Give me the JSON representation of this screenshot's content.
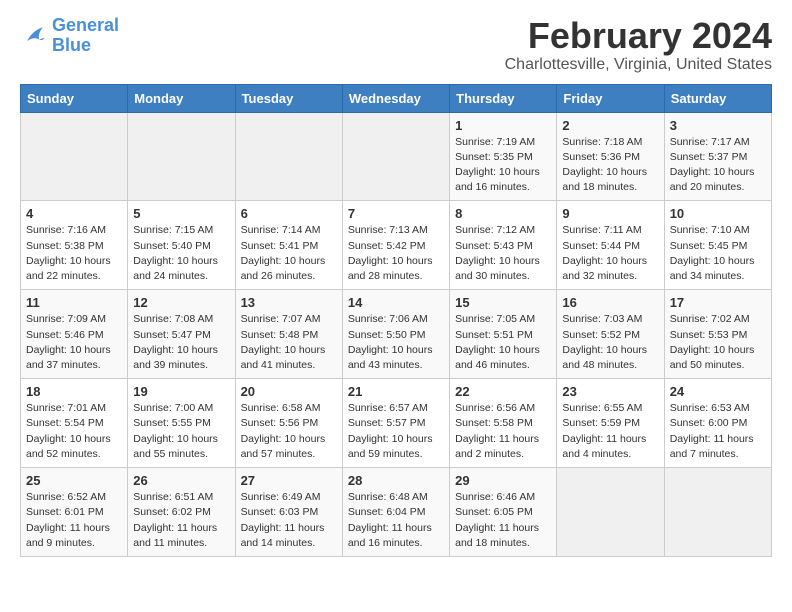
{
  "logo": {
    "line1": "General",
    "line2": "Blue"
  },
  "title": "February 2024",
  "subtitle": "Charlottesville, Virginia, United States",
  "weekdays": [
    "Sunday",
    "Monday",
    "Tuesday",
    "Wednesday",
    "Thursday",
    "Friday",
    "Saturday"
  ],
  "weeks": [
    [
      {
        "day": "",
        "empty": true
      },
      {
        "day": "",
        "empty": true
      },
      {
        "day": "",
        "empty": true
      },
      {
        "day": "",
        "empty": true
      },
      {
        "day": "1",
        "sunrise": "7:19 AM",
        "sunset": "5:35 PM",
        "daylight": "10 hours and 16 minutes."
      },
      {
        "day": "2",
        "sunrise": "7:18 AM",
        "sunset": "5:36 PM",
        "daylight": "10 hours and 18 minutes."
      },
      {
        "day": "3",
        "sunrise": "7:17 AM",
        "sunset": "5:37 PM",
        "daylight": "10 hours and 20 minutes."
      }
    ],
    [
      {
        "day": "4",
        "sunrise": "7:16 AM",
        "sunset": "5:38 PM",
        "daylight": "10 hours and 22 minutes."
      },
      {
        "day": "5",
        "sunrise": "7:15 AM",
        "sunset": "5:40 PM",
        "daylight": "10 hours and 24 minutes."
      },
      {
        "day": "6",
        "sunrise": "7:14 AM",
        "sunset": "5:41 PM",
        "daylight": "10 hours and 26 minutes."
      },
      {
        "day": "7",
        "sunrise": "7:13 AM",
        "sunset": "5:42 PM",
        "daylight": "10 hours and 28 minutes."
      },
      {
        "day": "8",
        "sunrise": "7:12 AM",
        "sunset": "5:43 PM",
        "daylight": "10 hours and 30 minutes."
      },
      {
        "day": "9",
        "sunrise": "7:11 AM",
        "sunset": "5:44 PM",
        "daylight": "10 hours and 32 minutes."
      },
      {
        "day": "10",
        "sunrise": "7:10 AM",
        "sunset": "5:45 PM",
        "daylight": "10 hours and 34 minutes."
      }
    ],
    [
      {
        "day": "11",
        "sunrise": "7:09 AM",
        "sunset": "5:46 PM",
        "daylight": "10 hours and 37 minutes."
      },
      {
        "day": "12",
        "sunrise": "7:08 AM",
        "sunset": "5:47 PM",
        "daylight": "10 hours and 39 minutes."
      },
      {
        "day": "13",
        "sunrise": "7:07 AM",
        "sunset": "5:48 PM",
        "daylight": "10 hours and 41 minutes."
      },
      {
        "day": "14",
        "sunrise": "7:06 AM",
        "sunset": "5:50 PM",
        "daylight": "10 hours and 43 minutes."
      },
      {
        "day": "15",
        "sunrise": "7:05 AM",
        "sunset": "5:51 PM",
        "daylight": "10 hours and 46 minutes."
      },
      {
        "day": "16",
        "sunrise": "7:03 AM",
        "sunset": "5:52 PM",
        "daylight": "10 hours and 48 minutes."
      },
      {
        "day": "17",
        "sunrise": "7:02 AM",
        "sunset": "5:53 PM",
        "daylight": "10 hours and 50 minutes."
      }
    ],
    [
      {
        "day": "18",
        "sunrise": "7:01 AM",
        "sunset": "5:54 PM",
        "daylight": "10 hours and 52 minutes."
      },
      {
        "day": "19",
        "sunrise": "7:00 AM",
        "sunset": "5:55 PM",
        "daylight": "10 hours and 55 minutes."
      },
      {
        "day": "20",
        "sunrise": "6:58 AM",
        "sunset": "5:56 PM",
        "daylight": "10 hours and 57 minutes."
      },
      {
        "day": "21",
        "sunrise": "6:57 AM",
        "sunset": "5:57 PM",
        "daylight": "10 hours and 59 minutes."
      },
      {
        "day": "22",
        "sunrise": "6:56 AM",
        "sunset": "5:58 PM",
        "daylight": "11 hours and 2 minutes."
      },
      {
        "day": "23",
        "sunrise": "6:55 AM",
        "sunset": "5:59 PM",
        "daylight": "11 hours and 4 minutes."
      },
      {
        "day": "24",
        "sunrise": "6:53 AM",
        "sunset": "6:00 PM",
        "daylight": "11 hours and 7 minutes."
      }
    ],
    [
      {
        "day": "25",
        "sunrise": "6:52 AM",
        "sunset": "6:01 PM",
        "daylight": "11 hours and 9 minutes."
      },
      {
        "day": "26",
        "sunrise": "6:51 AM",
        "sunset": "6:02 PM",
        "daylight": "11 hours and 11 minutes."
      },
      {
        "day": "27",
        "sunrise": "6:49 AM",
        "sunset": "6:03 PM",
        "daylight": "11 hours and 14 minutes."
      },
      {
        "day": "28",
        "sunrise": "6:48 AM",
        "sunset": "6:04 PM",
        "daylight": "11 hours and 16 minutes."
      },
      {
        "day": "29",
        "sunrise": "6:46 AM",
        "sunset": "6:05 PM",
        "daylight": "11 hours and 18 minutes."
      },
      {
        "day": "",
        "empty": true
      },
      {
        "day": "",
        "empty": true
      }
    ]
  ]
}
